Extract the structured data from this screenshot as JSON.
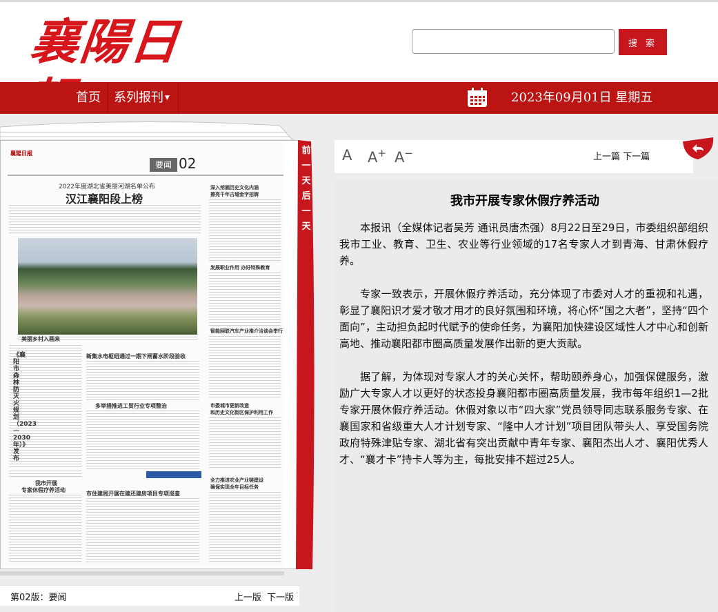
{
  "header": {
    "logo_text": "襄陽日報",
    "search_placeholder": "",
    "search_button": "搜 索"
  },
  "nav": {
    "home": "首页",
    "series": "系列报刊",
    "date": "2023年09月01日 星期五"
  },
  "paper": {
    "side_tabs": [
      "前",
      "一",
      "天",
      "后",
      "一",
      "天"
    ],
    "masthead": "襄陽日报",
    "section_label": "要闻",
    "page_number": "02",
    "headline_kicker": "2022年度湖北省美丽河湖名单公布",
    "headline_main": "汉江襄阳段上榜",
    "small_heads": [
      "美丽乡村入画来",
      "新集水电枢纽通过一期下闸蓄水阶段验收",
      "多举措推进工贸行业专项整治",
      "我市开展",
      "专家休假疗养活动",
      "市住建局开展在建还建房项目专项巡查",
      "深入挖掘历史文化内涵",
      "擦亮千年古城金字招牌",
      "发展职业作用 办好特殊教育",
      "智能网联汽车产业推介洽谈会举行",
      "市委城市更新改造",
      "和历史文化街区保护利用工作",
      "全力推进农业产业链建设",
      "确保实现全年目标任务"
    ],
    "vertical_head": "《襄阳市森林防灭火规划（2023—2030年）》发布"
  },
  "pager": {
    "edition": "第02版：要闻",
    "prev": "上一版",
    "next": "下一版"
  },
  "toolbar": {
    "font_normal": "A",
    "font_plus": "A",
    "plus_sign": "+",
    "font_minus": "A",
    "minus_sign": "−",
    "prev_article": "上一篇",
    "next_article": "下一篇"
  },
  "article": {
    "title": "我市开展专家休假疗养活动",
    "paragraphs": [
      "本报讯（全媒体记者吴芳 通讯员唐杰强）8月22日至29日，市委组织部组织我市工业、教育、卫生、农业等行业领域的17名专家人才到青海、甘肃休假疗养。",
      "专家一致表示，开展休假疗养活动，充分体现了市委对人才的重视和礼遇，彰显了襄阳识才爱才敬才用才的良好氛围和环境，将心怀“国之大者”，坚持“四个面向”，主动担负起时代赋予的使命任务，为襄阳加快建设区域性人才中心和创新高地、推动襄阳都市圈高质量发展作出新的更大贡献。",
      "据了解，为体现对专家人才的关心关怀，帮助颐养身心，加强保健服务，激励广大专家人才以更好的状态投身襄阳都市圈高质量发展，我市每年组织1—2批专家开展休假疗养活动。休假对象以市“四大家”党员领导同志联系服务专家、在襄国家和省级重大人才计划专家、“隆中人才计划”项目团队带头人、享受国务院政府特殊津贴专家、湖北省有突出贡献中青年专家、襄阳杰出人才、襄阳优秀人才、“襄才卡”持卡人等为主，每批安排不超过25人。"
    ]
  },
  "colors": {
    "brand_red": "#bc1313",
    "button_red": "#c8161e",
    "logo_red": "#d7161c",
    "article_bg": "#ebebeb"
  }
}
